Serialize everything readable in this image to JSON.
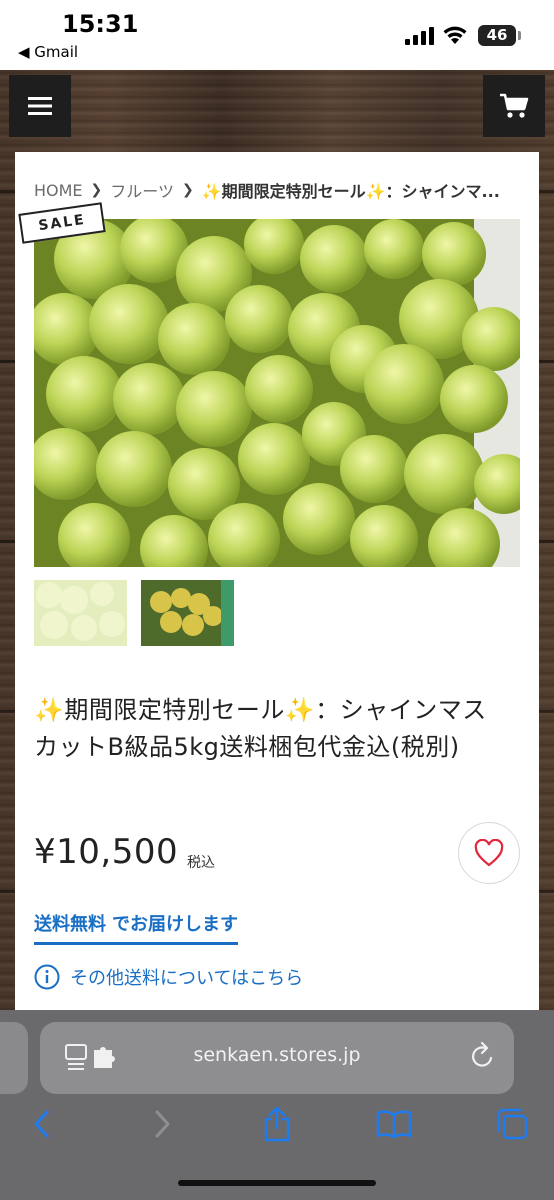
{
  "status_bar": {
    "time": "15:31",
    "back_app": "◀ Gmail",
    "battery": "46"
  },
  "header": {
    "menu_icon": "hamburger-menu-icon",
    "cart_icon": "shopping-cart-icon"
  },
  "breadcrumb": {
    "items": [
      "HOME",
      "フルーツ",
      "✨期間限定特別セール✨：シャインマ..."
    ]
  },
  "product": {
    "badge": "SALE",
    "title": "✨期間限定特別セール✨：シャインマスカットB級品5kg送料梱包代金込(税別)",
    "price": "¥10,500",
    "tax_label": "税込",
    "free_shipping_bold": "送料無料",
    "free_shipping_rest": "でお届けします",
    "shipping_info": "その他送料についてはこちら"
  },
  "browser": {
    "url": "senkaen.stores.jp"
  },
  "colors": {
    "link_blue": "#1a6fc4",
    "heart_red": "#e0283a",
    "header_button": "#1e1e1e"
  }
}
